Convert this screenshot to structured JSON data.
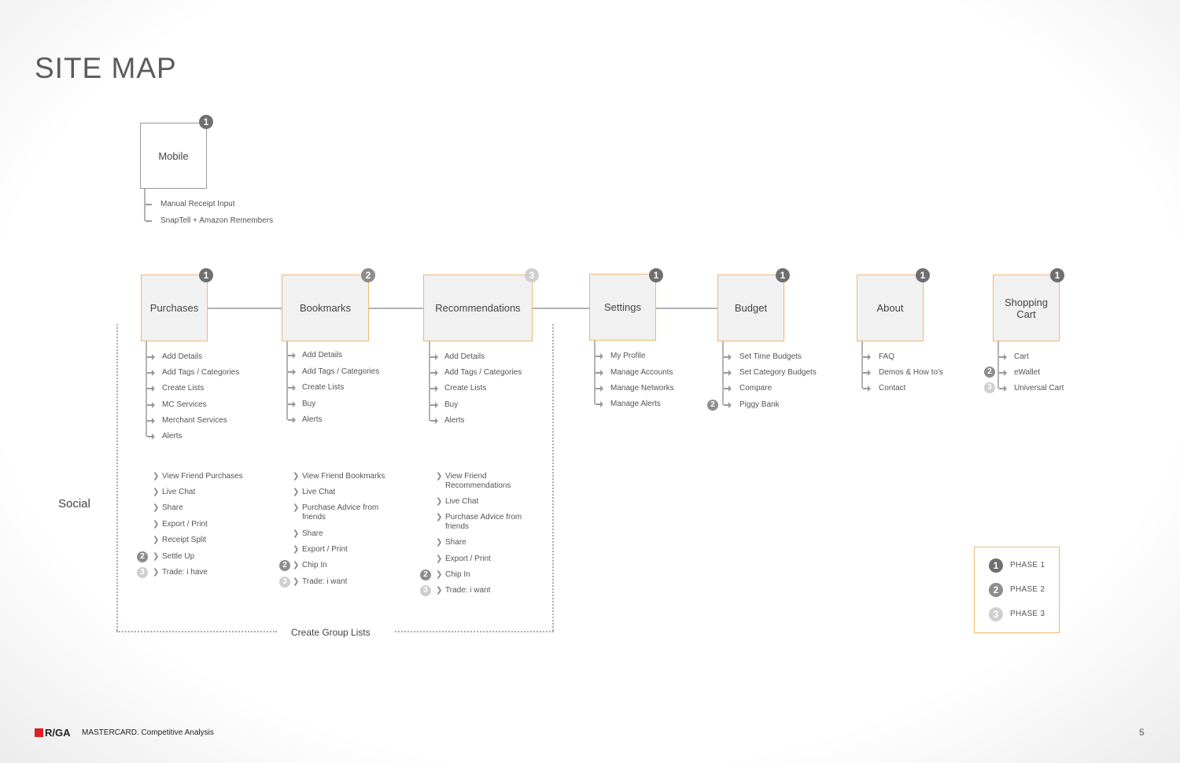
{
  "title": "SITE MAP",
  "mobile": {
    "label": "Mobile",
    "phase": "1",
    "items": [
      "Manual Receipt Input",
      "SnapTell + Amazon Remembers"
    ]
  },
  "sections": [
    {
      "label": "Purchases",
      "phase": "1",
      "items": [
        {
          "text": "Add Details"
        },
        {
          "text": "Add Tags / Categories"
        },
        {
          "text": "Create Lists"
        },
        {
          "text": "MC Services"
        },
        {
          "text": "Merchant Services"
        },
        {
          "text": "Alerts"
        }
      ],
      "social": [
        {
          "text": "View Friend Purchases"
        },
        {
          "text": "Live Chat"
        },
        {
          "text": "Share"
        },
        {
          "text": "Export / Print"
        },
        {
          "text": "Receipt Split"
        },
        {
          "text": "Settle Up",
          "phase": "2"
        },
        {
          "text": "Trade: i have",
          "phase": "3"
        }
      ]
    },
    {
      "label": "Bookmarks",
      "phase": "2",
      "items": [
        {
          "text": "Add Details"
        },
        {
          "text": "Add Tags / Categories"
        },
        {
          "text": "Create Lists"
        },
        {
          "text": "Buy"
        },
        {
          "text": "Alerts"
        }
      ],
      "social": [
        {
          "text": "View Friend Bookmarks"
        },
        {
          "text": "Live Chat"
        },
        {
          "text": "Purchase Advice from",
          "text2": "friends"
        },
        {
          "text": "Share"
        },
        {
          "text": "Export / Print"
        },
        {
          "text": "Chip In",
          "phase": "2"
        },
        {
          "text": "Trade: i want",
          "phase": "3"
        }
      ]
    },
    {
      "label": "Recommendations",
      "phase": "3",
      "items": [
        {
          "text": "Add Details"
        },
        {
          "text": "Add Tags / Categories"
        },
        {
          "text": "Create Lists"
        },
        {
          "text": "Buy"
        },
        {
          "text": "Alerts"
        }
      ],
      "social": [
        {
          "text": "View Friend",
          "text2": "Recommendations"
        },
        {
          "text": "Live Chat"
        },
        {
          "text": "Purchase Advice from",
          "text2": "friends"
        },
        {
          "text": "Share"
        },
        {
          "text": "Export / Print"
        },
        {
          "text": "Chip In",
          "phase": "2"
        },
        {
          "text": "Trade: i want",
          "phase": "3"
        }
      ]
    },
    {
      "label": "Settings",
      "phase": "1",
      "items": [
        {
          "text": "My Profile"
        },
        {
          "text": "Manage Accounts"
        },
        {
          "text": "Manage Networks"
        },
        {
          "text": "Manage Alerts"
        }
      ]
    },
    {
      "label": "Budget",
      "phase": "1",
      "items": [
        {
          "text": "Set Time Budgets"
        },
        {
          "text": "Set Category Budgets"
        },
        {
          "text": "Compare"
        },
        {
          "text": "Piggy Bank",
          "phase": "2"
        }
      ]
    },
    {
      "label": "About",
      "phase": "1",
      "items": [
        {
          "text": "FAQ"
        },
        {
          "text": "Demos & How to's"
        },
        {
          "text": "Contact"
        }
      ]
    },
    {
      "label": "Shopping\nCart",
      "phase": "1",
      "items": [
        {
          "text": "Cart"
        },
        {
          "text": "eWallet",
          "phase": "2"
        },
        {
          "text": "Universal Cart",
          "phase": "3"
        }
      ]
    }
  ],
  "social_label": "Social",
  "group_label": "Create Group Lists",
  "legend": [
    {
      "phase": "1",
      "label": "PHASE 1"
    },
    {
      "phase": "2",
      "label": "PHASE 2"
    },
    {
      "phase": "3",
      "label": "PHASE 3"
    }
  ],
  "footer": {
    "logo": "R/GA",
    "text": "MASTERCARD. Competitive Analysis",
    "page": "5"
  },
  "colors": {
    "accent": "#f0b872",
    "phase1": "#6f6f6f",
    "phase2": "#8d8d8d",
    "phase3": "#cfcfcf",
    "brand": "#e01f26"
  }
}
